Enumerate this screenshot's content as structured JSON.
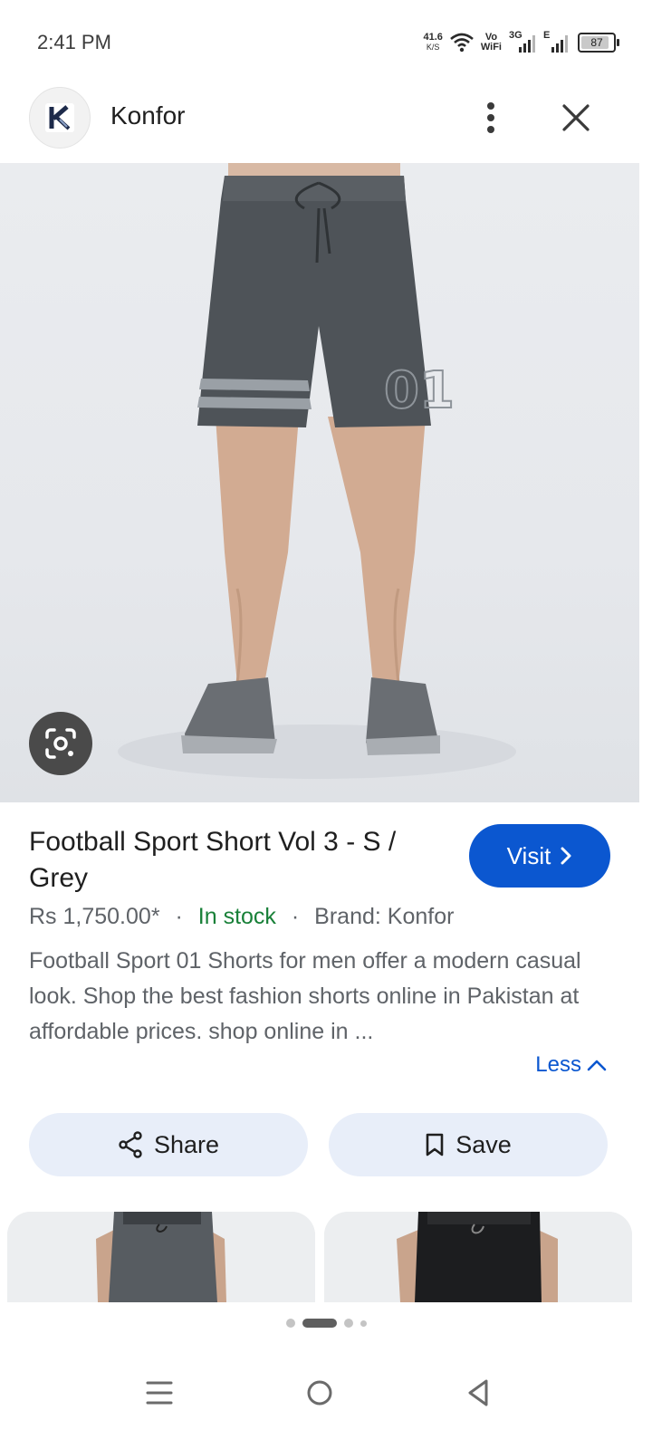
{
  "status_bar": {
    "time": "2:41 PM",
    "net_speed": "41.6",
    "net_unit": "K/S",
    "vowifi_top": "Vo",
    "vowifi_bottom": "WiFi",
    "signal1_label": "3G",
    "signal2_label": "E",
    "battery": "87",
    "battery_level": 0.87,
    "icons": [
      "wifi-icon",
      "signal-icon",
      "signal-icon",
      "battery-icon"
    ]
  },
  "header": {
    "site_name": "Konfor",
    "logo_letter": "K",
    "icons": [
      "konfor-logo-icon",
      "more-vert-icon",
      "close-icon"
    ]
  },
  "hero": {
    "jersey_number": "01",
    "icons": [
      "google-lens-icon"
    ]
  },
  "product": {
    "title": "Football Sport Short Vol 3 - S / Grey",
    "visit_label": "Visit",
    "price": "Rs 1,750.00*",
    "separator": "·",
    "stock": "In stock",
    "brand": "Brand: Konfor",
    "description": "Football Sport 01 Shorts for men offer a modern casual look. Shop the best fashion shorts online in Pakistan at affordable prices. shop online in ...",
    "less_label": "Less"
  },
  "actions": {
    "share_label": "Share",
    "save_label": "Save"
  },
  "colors": {
    "accent": "#0b57d0",
    "stock_green": "#188038",
    "pill_bg": "#e8eef9",
    "text_secondary": "#5f6368"
  },
  "nav": {
    "icons": [
      "recent-apps-icon",
      "home-icon",
      "back-icon"
    ]
  }
}
